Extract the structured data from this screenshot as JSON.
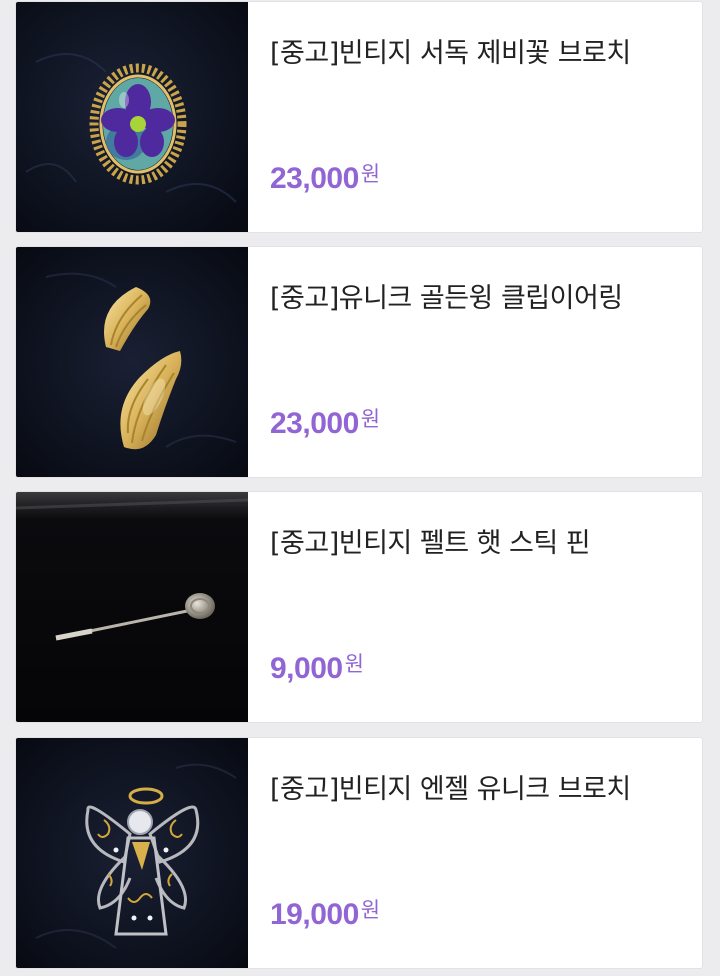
{
  "products": [
    {
      "title": "[중고]빈티지 서독 제비꽃 브로치",
      "price": "23,000",
      "currency": "원",
      "image_icon": "violet-brooch-photo"
    },
    {
      "title": "[중고]유니크 골든윙 클립이어링",
      "price": "23,000",
      "currency": "원",
      "image_icon": "gold-wing-earrings-photo"
    },
    {
      "title": "[중고]빈티지 펠트 햇 스틱 핀",
      "price": "9,000",
      "currency": "원",
      "image_icon": "hat-stick-pin-photo"
    },
    {
      "title": "[중고]빈티지 엔젤 유니크 브로치",
      "price": "19,000",
      "currency": "원",
      "image_icon": "angel-brooch-photo"
    }
  ],
  "colors": {
    "price": "#9165d3",
    "title": "#222222",
    "page_background": "#ececee",
    "card_background": "#ffffff",
    "photo_background": "#0d1220"
  }
}
